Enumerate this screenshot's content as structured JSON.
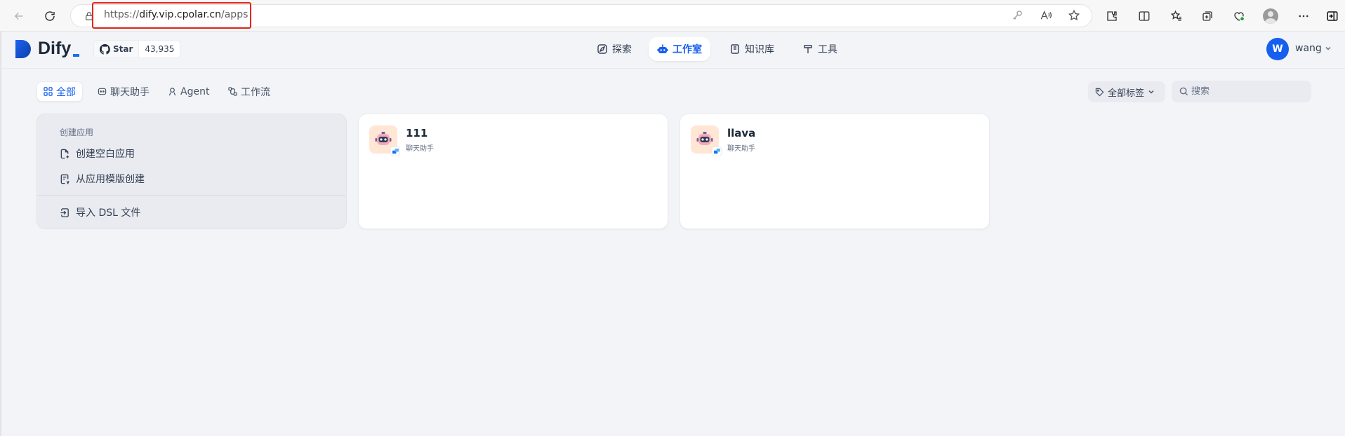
{
  "browser": {
    "url_scheme": "https://",
    "url_host": "dify.vip.cpolar.cn",
    "url_path": "/apps"
  },
  "header": {
    "logo_text": "Dify",
    "github": {
      "star_label": "Star",
      "star_count": "43,935"
    },
    "nav": [
      {
        "label": "探索",
        "icon": "compass-icon",
        "active": false
      },
      {
        "label": "工作室",
        "icon": "robot-icon",
        "active": true
      },
      {
        "label": "知识库",
        "icon": "book-icon",
        "active": false
      },
      {
        "label": "工具",
        "icon": "hammer-icon",
        "active": false
      }
    ],
    "user": {
      "initial": "W",
      "name": "wang"
    }
  },
  "filters": {
    "tabs": [
      {
        "label": "全部",
        "icon": "grid-icon",
        "active": true
      },
      {
        "label": "聊天助手",
        "icon": "chat-bot-icon",
        "active": false
      },
      {
        "label": "Agent",
        "icon": "agent-icon",
        "active": false
      },
      {
        "label": "工作流",
        "icon": "workflow-icon",
        "active": false
      }
    ],
    "tag_select_label": "全部标签",
    "search_placeholder": "搜索"
  },
  "create_card": {
    "title": "创建应用",
    "items": [
      {
        "label": "创建空白应用",
        "icon": "file-plus-icon"
      },
      {
        "label": "从应用模版创建",
        "icon": "template-icon"
      },
      {
        "label": "导入 DSL 文件",
        "icon": "import-icon"
      }
    ]
  },
  "apps": [
    {
      "name": "111",
      "type": "聊天助手"
    },
    {
      "name": "llava",
      "type": "聊天助手"
    }
  ],
  "colors": {
    "accent": "#155eef",
    "highlight_box": "#e3261c",
    "app_icon_bg": "#ffe6d5",
    "page_bg": "#f2f4f7"
  }
}
